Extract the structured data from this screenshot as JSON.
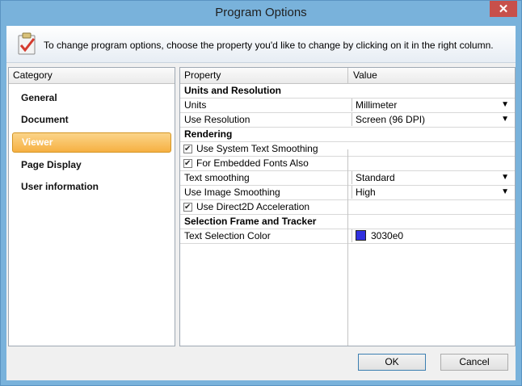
{
  "window": {
    "title": "Program Options"
  },
  "banner": {
    "text": "To change program options, choose the property you'd like to change by clicking on it in the right column."
  },
  "categories": {
    "header": "Category",
    "items": [
      {
        "label": "General"
      },
      {
        "label": "Document"
      },
      {
        "label": "Viewer",
        "selected": true
      },
      {
        "label": "Page Display"
      },
      {
        "label": "User information"
      }
    ]
  },
  "properties": {
    "header_property": "Property",
    "header_value": "Value",
    "groups": [
      {
        "title": "Units and Resolution",
        "rows": [
          {
            "name": "Units",
            "value": "Millimeter",
            "dropdown": true
          },
          {
            "name": "Use Resolution",
            "value": "Screen (96 DPI)",
            "dropdown": true
          }
        ]
      },
      {
        "title": "Rendering",
        "rows": [
          {
            "name": "Use System Text Smoothing",
            "checkbox": true,
            "checked": true
          },
          {
            "name": "For Embedded Fonts Also",
            "checkbox": true,
            "checked": true
          },
          {
            "name": "Text smoothing",
            "value": "Standard",
            "dropdown": true
          },
          {
            "name": "Use Image Smoothing",
            "value": "High",
            "dropdown": true
          },
          {
            "name": "Use Direct2D Acceleration",
            "checkbox": true,
            "checked": true
          }
        ]
      },
      {
        "title": "Selection Frame and Tracker",
        "rows": [
          {
            "name": "Text Selection Color",
            "value": "3030e0",
            "swatch": "#3030e0"
          }
        ]
      }
    ]
  },
  "buttons": {
    "ok": "OK",
    "cancel": "Cancel"
  },
  "colors": {
    "selected_category": "#f6b042",
    "title_bar": "#79b2db",
    "close_button": "#c7504b"
  }
}
